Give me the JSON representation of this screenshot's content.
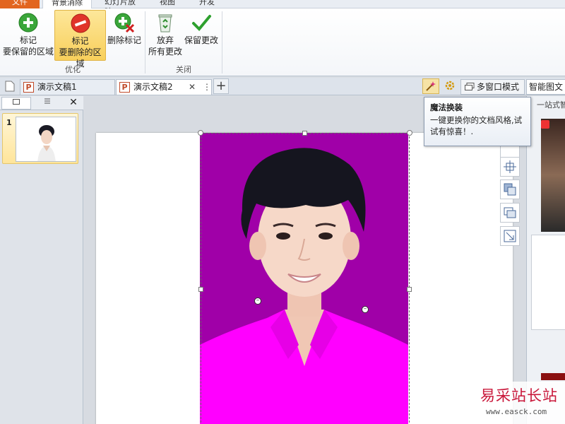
{
  "ribbon": {
    "tabs": [
      {
        "label": "文件"
      },
      {
        "label": "背景消除"
      },
      {
        "label": "幻灯片放映"
      },
      {
        "label": "视图"
      },
      {
        "label": "开发"
      }
    ],
    "buttons": {
      "mark_keep": {
        "line1": "标记",
        "line2": "要保留的区域"
      },
      "mark_remove": {
        "line1": "标记",
        "line2": "要删除的区域"
      },
      "delete_mark": {
        "label": "删除标记"
      },
      "discard": {
        "line1": "放弃",
        "line2": "所有更改"
      },
      "keep_changes": {
        "label": "保留更改"
      }
    },
    "groups": {
      "optimize": "优化",
      "close": "关闭"
    }
  },
  "doc_tabs": {
    "tabs": [
      {
        "label": "演示文稿1",
        "icon": "P"
      },
      {
        "label": "演示文稿2",
        "icon": "P"
      }
    ],
    "close_glyph": "✕",
    "more_glyph": "⋮",
    "add_glyph": "+",
    "multi_window": "多窗口模式",
    "smart_text": "智能图文"
  },
  "left_pane": {
    "close_glyph": "✕",
    "slide_number": "1"
  },
  "tooltip": {
    "title": "魔法换装",
    "body": "一键更换你的文档风格,试试有惊喜！."
  },
  "right_pane": {
    "partial_text": "一站式智能"
  },
  "watermark": {
    "cn": "易采站长站",
    "url": "www.easck.com"
  },
  "colors": {
    "photo_background": "#a000a8",
    "shirt": "#ff00ff",
    "active_button": "#f8cf5b"
  }
}
